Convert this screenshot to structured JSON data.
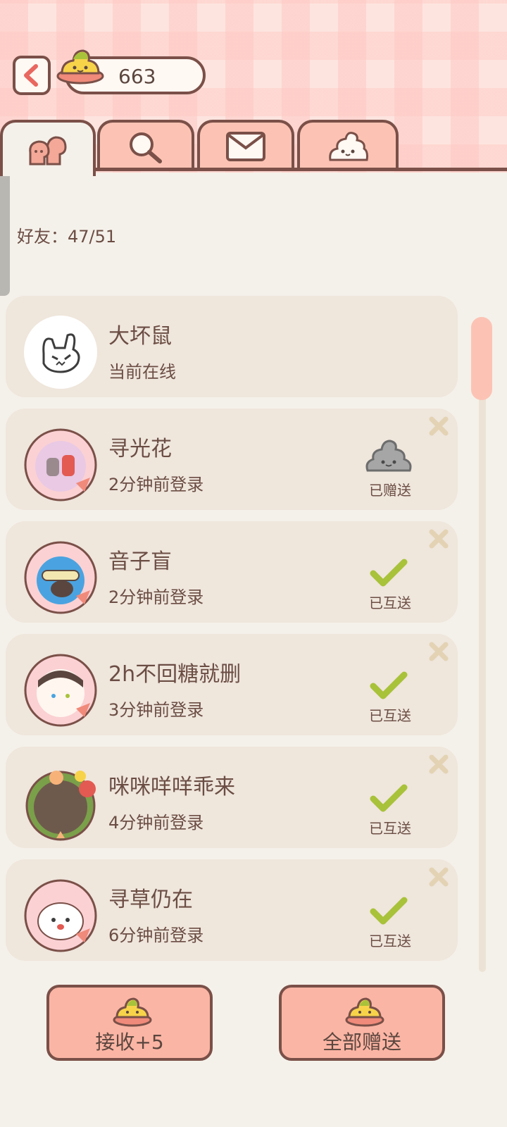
{
  "header": {
    "candy_count": "663"
  },
  "tabs": [
    {
      "name": "friends",
      "icon": "friends-icon",
      "active": true
    },
    {
      "name": "search",
      "icon": "search-icon",
      "active": false
    },
    {
      "name": "mail",
      "icon": "mail-icon",
      "active": false
    },
    {
      "name": "candy",
      "icon": "candy-icon",
      "active": false
    }
  ],
  "friends_label": "好友：47/51",
  "friends": [
    {
      "name": "大坏鼠",
      "status": "当前在线",
      "action": "",
      "action_icon": ""
    },
    {
      "name": "寻光花",
      "status": "2分钟前登录",
      "action": "已赠送",
      "action_icon": "grey-candy-icon"
    },
    {
      "name": "音子盲",
      "status": "2分钟前登录",
      "action": "已互送",
      "action_icon": "check-icon"
    },
    {
      "name": "2h不回糖就删",
      "status": "3分钟前登录",
      "action": "已互送",
      "action_icon": "check-icon"
    },
    {
      "name": "咪咪咩咩乖来",
      "status": "4分钟前登录",
      "action": "已互送",
      "action_icon": "check-icon"
    },
    {
      "name": "寻草仍在",
      "status": "6分钟前登录",
      "action": "已互送",
      "action_icon": "check-icon"
    }
  ],
  "buttons": {
    "receive": "接收+5",
    "send_all": "全部赠送"
  },
  "colors": {
    "accent": "#fbb5a4",
    "border": "#7a5048",
    "check": "#a8c23a",
    "card": "#efe6dc"
  }
}
